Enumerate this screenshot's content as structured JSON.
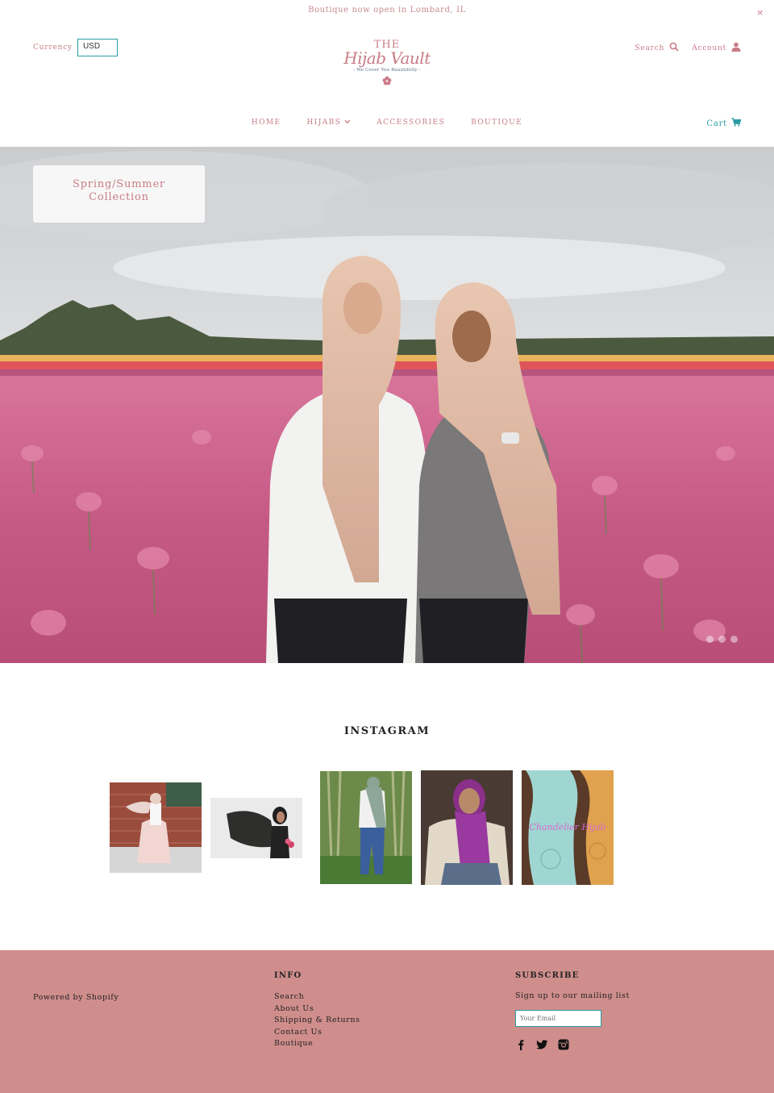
{
  "announcement": {
    "text": "Boutique now open in Lombard, IL",
    "close_icon": "×"
  },
  "header": {
    "currency_label": "Currency",
    "currency_value": "USD",
    "logo": {
      "line1": "THE",
      "line2": "Hijab Vault",
      "tagline": "- We Cover You Beautifully -"
    },
    "search_label": "Search",
    "account_label": "Account",
    "cart_label": "Cart"
  },
  "nav": {
    "items": [
      {
        "label": "HOME"
      },
      {
        "label": "HIJABS",
        "has_dropdown": true
      },
      {
        "label": "ACCESSORIES"
      },
      {
        "label": "BOUTIQUE"
      }
    ]
  },
  "hero": {
    "caption_line1": "Spring/Summer",
    "caption_line2": "Collection",
    "slide_count": 3
  },
  "instagram": {
    "title": "INSTAGRAM",
    "posts": [
      {
        "name": "instagram-post-1"
      },
      {
        "name": "instagram-post-2"
      },
      {
        "name": "instagram-post-3"
      },
      {
        "name": "instagram-post-4"
      },
      {
        "name": "instagram-post-5",
        "overlay_text": "Chandelier Hijab"
      }
    ]
  },
  "footer": {
    "powered_by": "Powered by Shopify",
    "info_heading": "INFO",
    "info_links": [
      "Search",
      "About Us",
      "Shipping & Returns",
      "Contact Us",
      "Boutique"
    ],
    "subscribe_heading": "SUBSCRIBE",
    "subscribe_text": "Sign up to our mailing list",
    "email_placeholder": "Your Email",
    "social_icons": [
      "facebook-icon",
      "twitter-icon",
      "instagram-icon"
    ]
  },
  "colors": {
    "accent_pink": "#c97c86",
    "accent_teal": "#2a9da3",
    "footer_bg": "#cf8e8c"
  }
}
